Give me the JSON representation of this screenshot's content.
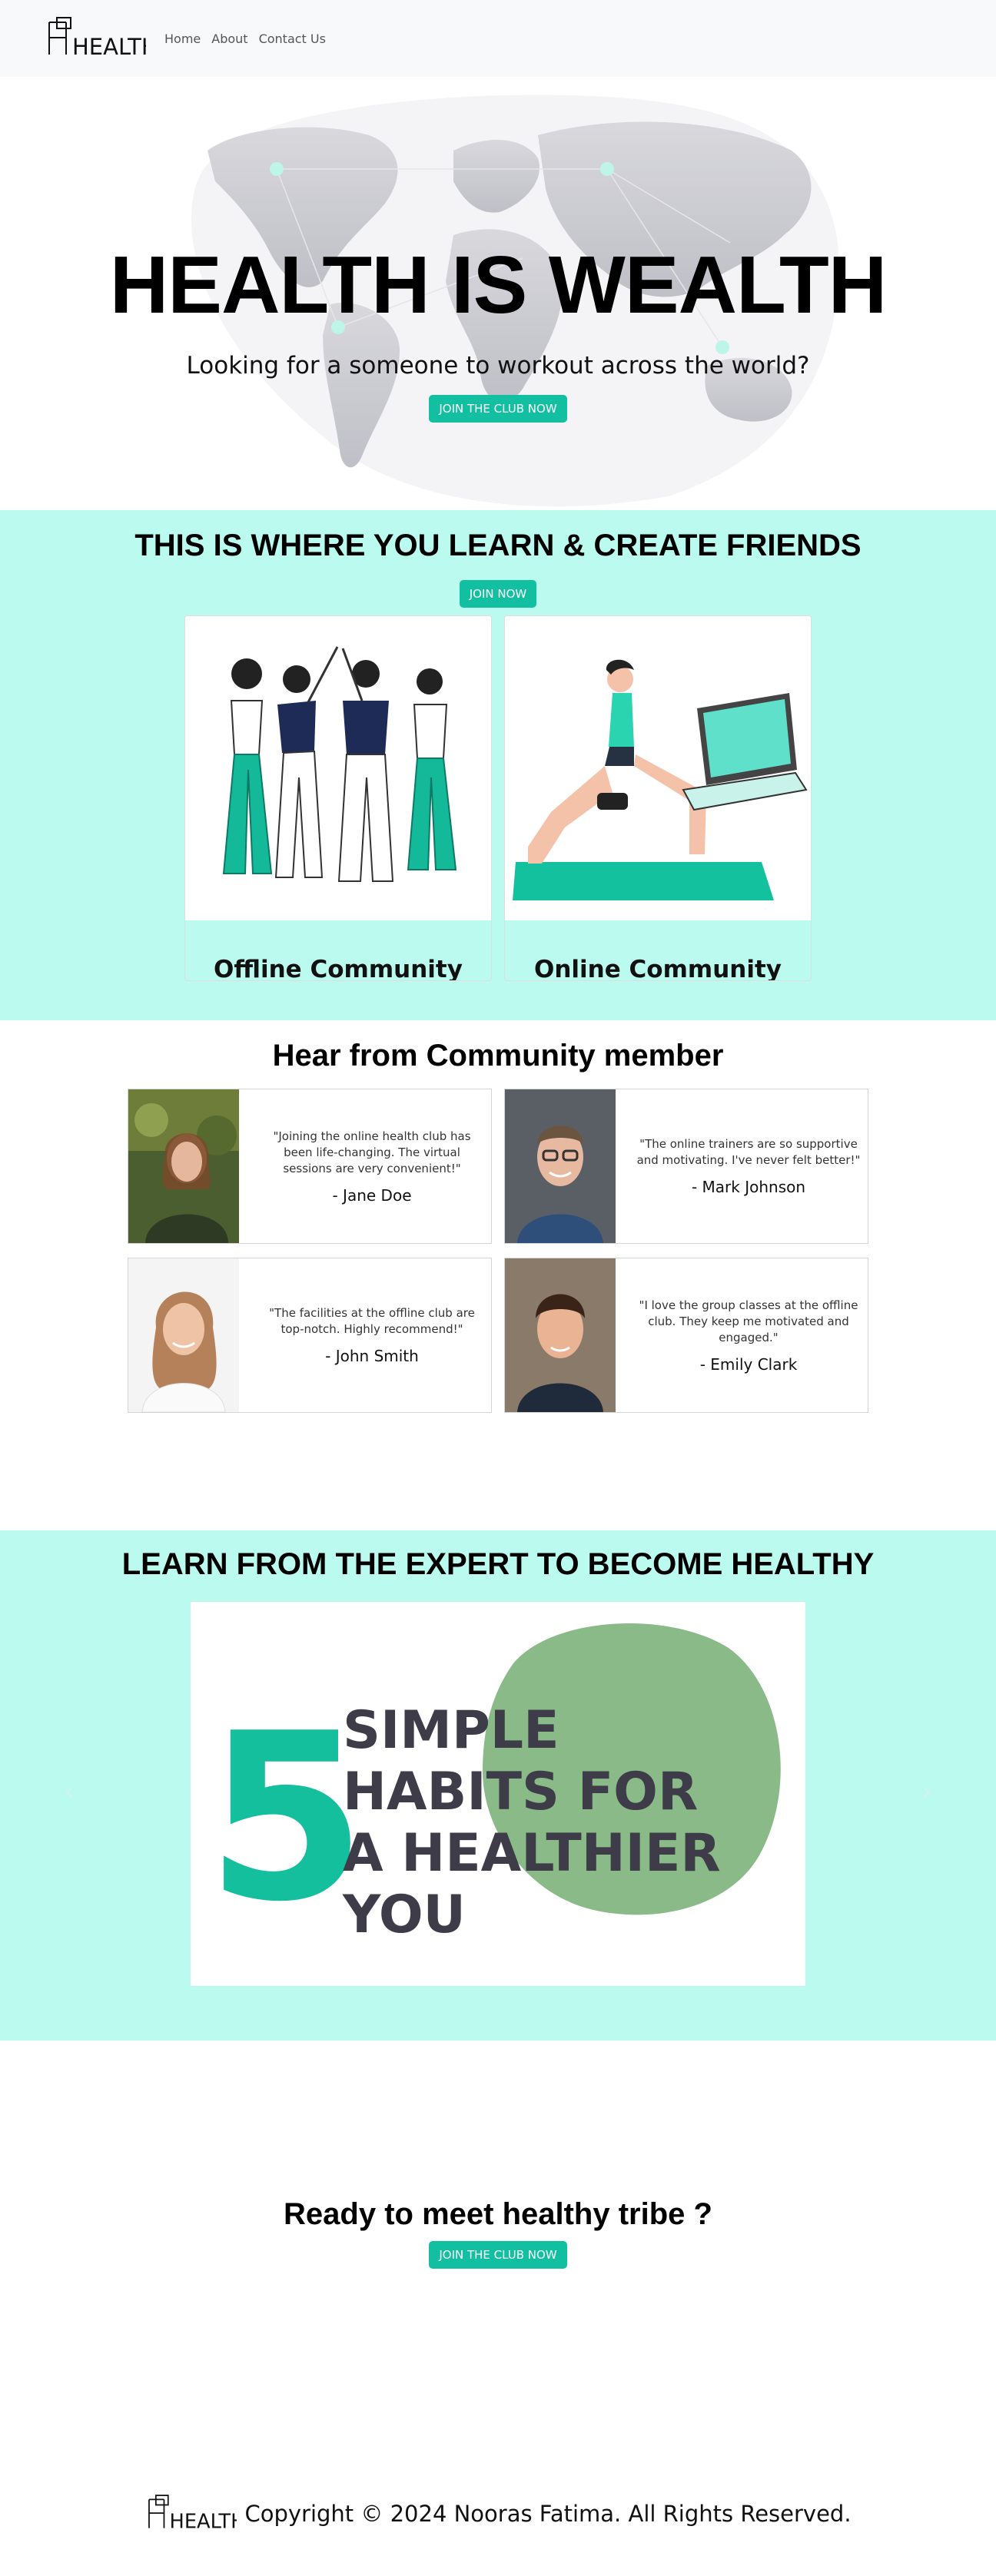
{
  "nav": {
    "logo_text": "HEALTH",
    "links": [
      "Home",
      "About",
      "Contact Us"
    ]
  },
  "hero": {
    "title": "HEALTH IS WEALTH",
    "subtitle": "Looking for a someone to workout across the world?",
    "button": "JOIN THE CLUB NOW"
  },
  "friends": {
    "title": "THIS IS WHERE YOU LEARN & CREATE FRIENDS",
    "button": "JOIN NOW",
    "cards": [
      {
        "title": "Offline Community",
        "image": "group-high-five-illustration"
      },
      {
        "title": "Online Community",
        "image": "woman-lunge-laptop-illustration"
      }
    ]
  },
  "testimonials": {
    "title": "Hear from Community member",
    "items": [
      {
        "quote": "\"Joining the online health club has been life-changing. The virtual sessions are very convenient!\"",
        "name": "- Jane Doe"
      },
      {
        "quote": "\"The online trainers are so supportive and motivating. I've never felt better!\"",
        "name": "- Mark Johnson"
      },
      {
        "quote": "\"The facilities at the offline club are top-notch. Highly recommend!\"",
        "name": "- John Smith"
      },
      {
        "quote": "\"I love the group classes at the offline club. They keep me motivated and engaged.\"",
        "name": "- Emily Clark"
      }
    ]
  },
  "expert": {
    "title": "LEARN FROM THE EXPERT TO BECOME HEALTHY",
    "slide": {
      "number": "5",
      "lines": [
        "SIMPLE",
        "HABITS FOR",
        "A HEALTHIER",
        "YOU"
      ]
    },
    "prev": "‹",
    "next": "›"
  },
  "cta": {
    "title": "Ready to meet healthy tribe ?",
    "button": "JOIN THE CLUB NOW"
  },
  "footer": {
    "logo_text": "HEALTH",
    "copyright": "Copyright © 2024 Nooras Fatima. All Rights Reserved."
  },
  "colors": {
    "accent": "#12bfa0",
    "mint_bg": "#bbfaee",
    "navbar_bg": "#f8f9fa",
    "blob_green": "#8aba88",
    "slide_text": "#3e3c48"
  }
}
